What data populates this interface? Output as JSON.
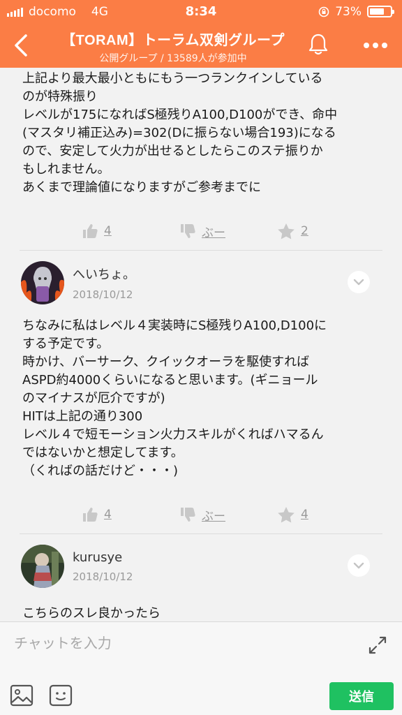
{
  "status": {
    "carrier": "docomo",
    "network": "4G",
    "time": "8:34",
    "battery": "73%",
    "battery_level": 0.73
  },
  "header": {
    "title": "【TORAM】トーラム双剣グループ",
    "subtitle": "公開グループ / 13589人が参加中"
  },
  "messages": [
    {
      "text": "上記より最大最小ともにもう一つランクインしている\nのが特殊振り\nレベルが175になればS極残りA100,D100ができ、命中\n(マスタリ補正込み)=302(Dに振らない場合193)になる\nので、安定して火力が出せるとしたらこのステ振りか\nもしれません。\nあくまで理論値になりますがご参考までに",
      "likes": "4",
      "boo": "ぶー",
      "stars": "2"
    },
    {
      "user": "へいちょ。",
      "date": "2018/10/12",
      "text": "ちなみに私はレベル４実装時にS極残りA100,D100に\nする予定です。\n時かけ、バーサーク、クイックオーラを駆使すれば\nASPD約4000くらいになると思います。(ギニョール\nのマイナスが厄介ですが)\nHITは上記の通り300\nレベル４で短モーション火力スキルがくればハマるん\nではないかと想定してます。\n（くればの話だけど・・・)",
      "likes": "4",
      "boo": "ぶー",
      "stars": "4"
    },
    {
      "user": "kurusye",
      "date": "2018/10/12",
      "text": "こちらのスレ良かったら\nまとめに入れさせて下さいな"
    }
  ],
  "composer": {
    "placeholder": "チャットを入力",
    "send_label": "送信"
  },
  "colors": {
    "header": "#fb7d45",
    "send": "#1fc161"
  }
}
